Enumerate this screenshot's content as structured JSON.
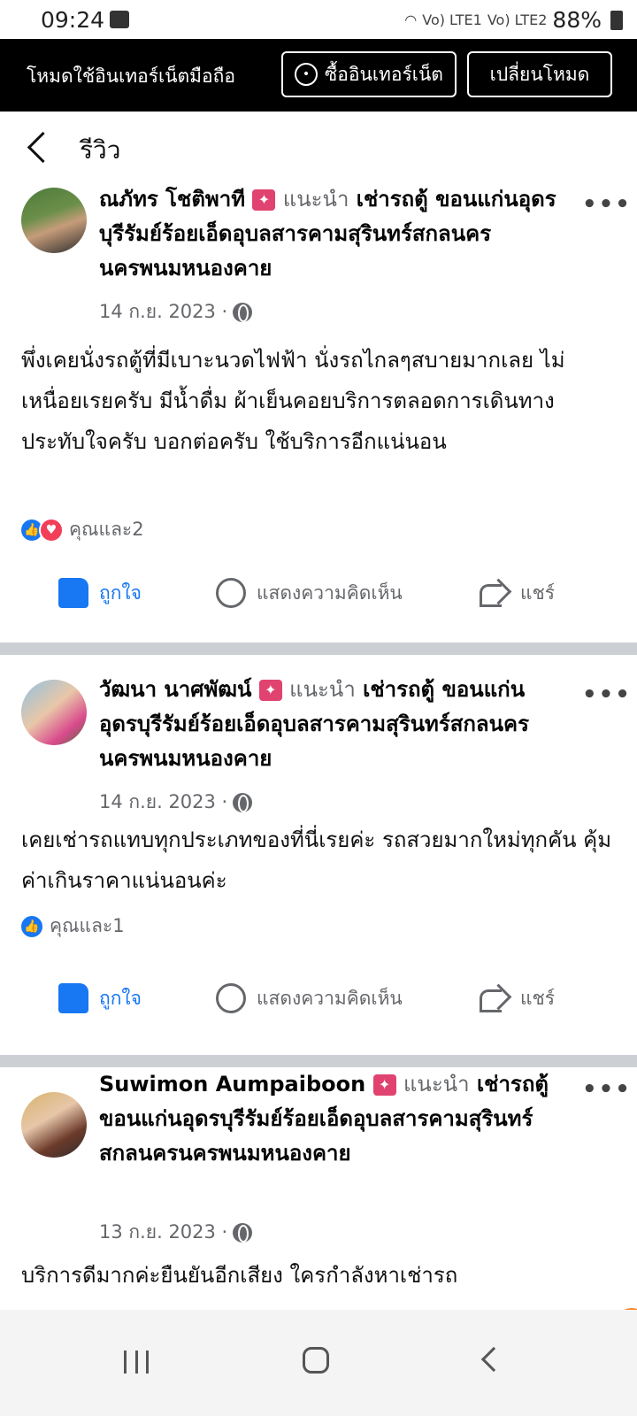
{
  "status_bar": {
    "time": "09:24",
    "signal_1": "Vo) LTE1",
    "signal_2": "Vo) LTE2",
    "battery": "88%"
  },
  "banner": {
    "text": "โหมดใช้อินเทอร์เน็ตมือถือ",
    "buy_label": "ซื้ออินเทอร์เน็ต",
    "switch_label": "เปลี่ยนโหมด"
  },
  "header": {
    "title": "รีวิว"
  },
  "reviews": [
    {
      "author": "ณภัทร โชติพาที",
      "recommend": "แนะนำ",
      "page": "เช่ารถตู้ ขอนแก่นอุดรบุรีรัมย์ร้อยเอ็ดอุบลสารคามสุรินทร์สกลนครนครพนมหนองคาย",
      "date": "14 ก.ย. 2023 ·",
      "text": "พึ่งเคยนั่งรถตู้ที่มีเบาะนวดไฟฟ้า นั่งรถไกลๆสบายมากเลย ไม่เหนื่อยเรยครับ มีน้ำดื่ม ผ้าเย็นคอยบริการตลอดการเดินทาง ประทับใจครับ บอกต่อครับ ใช้บริการอีกแน่นอน",
      "reactions": "คุณและ2"
    },
    {
      "author": "วัฒนา นาศพัฒน์",
      "recommend": "แนะนำ",
      "page": "เช่ารถตู้ ขอนแก่นอุดรบุรีรัมย์ร้อยเอ็ดอุบลสารคามสุรินทร์สกลนครนครพนมหนองคาย",
      "date": "14 ก.ย. 2023 ·",
      "text": "เคยเช่ารถแทบทุกประเภทของที่นี่เรยค่ะ รถสวยมากใหม่ทุกคัน คุ้มค่าเกินราคาแน่นอนค่ะ",
      "reactions": "คุณและ1"
    },
    {
      "author": "Suwimon Aumpaiboon",
      "recommend": "แนะนำ",
      "page": "เช่ารถตู้ ขอนแก่นอุดรบุรีรัมย์ร้อยเอ็ดอุบลสารคามสุรินทร์สกลนครนครพนมหนองคาย",
      "date": "13 ก.ย. 2023 ·",
      "text": "บริการดีมากค่ะยืนยันอีกเสียง ใครกำลังหาเช่ารถ"
    }
  ],
  "actions": {
    "like": "ถูกใจ",
    "comment": "แสดงความคิดเห็น",
    "share": "แชร์"
  },
  "colors": {
    "accent": "#1877f2",
    "love": "#f33e58",
    "badge": "#e0436f",
    "separator": "#ccd0d5"
  }
}
